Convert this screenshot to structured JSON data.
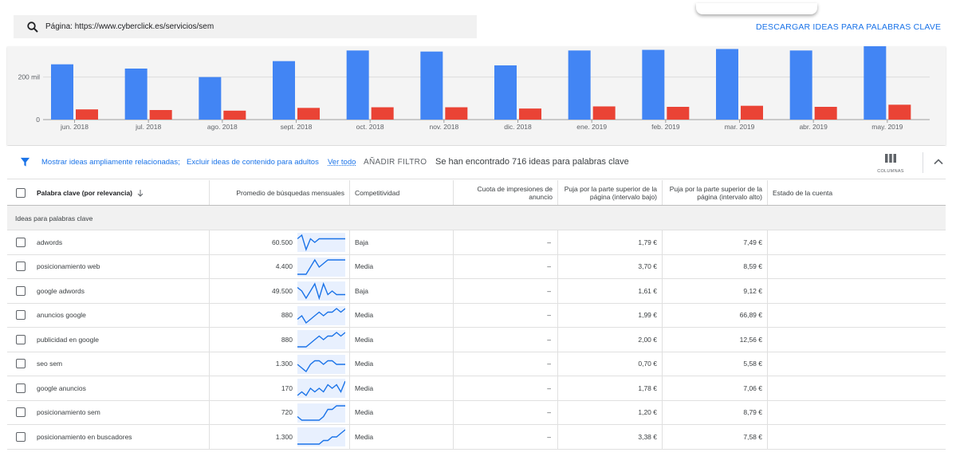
{
  "search": {
    "text": "Página: https://www.cyberclick.es/servicios/sem"
  },
  "download_label": "DESCARGAR IDEAS PARA PALABRAS CLAVE",
  "chart_data": {
    "type": "bar",
    "categories": [
      "jun. 2018",
      "jul. 2018",
      "ago. 2018",
      "sept. 2018",
      "oct. 2018",
      "nov. 2018",
      "dic. 2018",
      "ene. 2019",
      "feb. 2019",
      "mar. 2019",
      "abr. 2019",
      "may. 2019"
    ],
    "series": [
      {
        "color": "#4285f4",
        "values": [
          260000,
          240000,
          200000,
          275000,
          325000,
          320000,
          255000,
          325000,
          328000,
          332000,
          325000,
          360000
        ]
      },
      {
        "color": "#ea4335",
        "values": [
          48000,
          45000,
          42000,
          55000,
          58000,
          58000,
          52000,
          62000,
          60000,
          65000,
          60000,
          70000
        ]
      }
    ],
    "ytick_labels": [
      "0",
      "200 mil"
    ],
    "yticks": [
      0,
      200000
    ],
    "ylim": [
      0,
      345000
    ],
    "grid": true
  },
  "filter": {
    "text1": "Mostrar ideas ampliamente relacionadas;",
    "text2": "Excluir ideas de contenido para adultos",
    "see_all": "Ver todo",
    "add_filter": "AÑADIR FILTRO",
    "found": "Se han encontrado 716 ideas para palabras clave",
    "columns_label": "COLUMNAS"
  },
  "table": {
    "headers": {
      "keyword": "Palabra clave (por relevancia)",
      "avg_searches": "Promedio de búsquedas mensuales",
      "competition": "Competitividad",
      "impression_share": "Cuota de impresiones de anuncio",
      "bid_low": "Puja por la parte superior de la página (intervalo bajo)",
      "bid_high": "Puja por la parte superior de la página (intervalo alto)",
      "account_status": "Estado de la cuenta"
    },
    "group_label": "Ideas para palabras clave",
    "rows": [
      {
        "keyword": "adwords",
        "searches": "60.500",
        "competition": "Baja",
        "share": "–",
        "low": "1,79 €",
        "high": "7,49 €",
        "trend": [
          4,
          5,
          1,
          4,
          3,
          4,
          4,
          4,
          4,
          4,
          4,
          4
        ]
      },
      {
        "keyword": "posicionamiento web",
        "searches": "4.400",
        "competition": "Media",
        "share": "–",
        "low": "3,70 €",
        "high": "8,59 €",
        "trend": [
          1,
          1,
          1,
          3,
          5,
          3,
          4,
          5,
          5,
          5,
          5,
          5
        ]
      },
      {
        "keyword": "google adwords",
        "searches": "49.500",
        "competition": "Baja",
        "share": "–",
        "low": "1,61 €",
        "high": "9,12 €",
        "trend": [
          4,
          3,
          1,
          3,
          5,
          1,
          5,
          2,
          3,
          2,
          2,
          2
        ]
      },
      {
        "keyword": "anuncios google",
        "searches": "880",
        "competition": "Media",
        "share": "–",
        "low": "1,99 €",
        "high": "66,89 €",
        "trend": [
          2,
          3,
          1,
          2,
          3,
          4,
          3,
          4,
          4,
          5,
          4,
          5
        ]
      },
      {
        "keyword": "publicidad en google",
        "searches": "880",
        "competition": "Media",
        "share": "–",
        "low": "2,00 €",
        "high": "12,56 €",
        "trend": [
          1,
          1,
          1,
          2,
          3,
          4,
          3,
          4,
          4,
          5,
          4,
          5
        ]
      },
      {
        "keyword": "seo sem",
        "searches": "1.300",
        "competition": "Media",
        "share": "–",
        "low": "0,70 €",
        "high": "5,58 €",
        "trend": [
          3,
          2,
          1,
          3,
          4,
          4,
          3,
          4,
          4,
          3,
          3,
          3
        ]
      },
      {
        "keyword": "google anuncios",
        "searches": "170",
        "competition": "Media",
        "share": "–",
        "low": "1,78 €",
        "high": "7,06 €",
        "trend": [
          1,
          2,
          1,
          3,
          2,
          3,
          2,
          4,
          3,
          4,
          2,
          5
        ]
      },
      {
        "keyword": "posicionamiento sem",
        "searches": "720",
        "competition": "Media",
        "share": "–",
        "low": "1,20 €",
        "high": "8,79 €",
        "trend": [
          2,
          1,
          1,
          1,
          1,
          1,
          2,
          4,
          4,
          5,
          5,
          5
        ]
      },
      {
        "keyword": "posicionamiento en buscadores",
        "searches": "1.300",
        "competition": "Media",
        "share": "–",
        "low": "3,38 €",
        "high": "7,58 €",
        "trend": [
          1,
          1,
          1,
          1,
          1,
          1,
          2,
          2,
          3,
          3,
          4,
          5
        ]
      }
    ]
  },
  "icons": {
    "search": "search-icon",
    "filter": "filter-icon",
    "columns": "columns-icon",
    "collapse": "chevron-up-icon",
    "sort": "arrow-down-icon"
  },
  "colors": {
    "accent": "#1a73e8",
    "bar_blue": "#4285f4",
    "bar_red": "#ea4335",
    "spark": "#1a73e8"
  }
}
